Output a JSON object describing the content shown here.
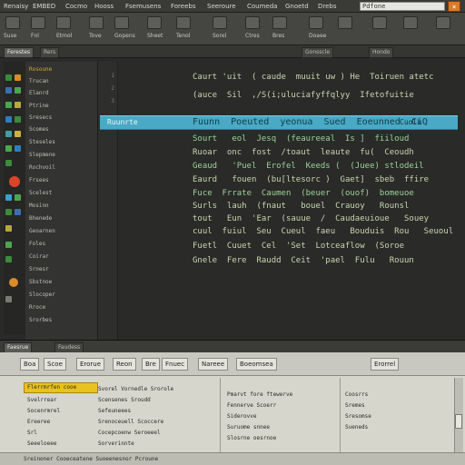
{
  "menubar": {
    "items": [
      "Renaisy",
      "EMBED",
      "Cocmo",
      "Hooss",
      "Fsemusens",
      "Foreebs",
      "Seeroure",
      "Coumeda",
      "Gnoetd",
      "Drebs"
    ],
    "title_field": "Pdfone",
    "close_icon": "close-icon"
  },
  "toolbar": {
    "labels": [
      "Suse",
      "Fnl",
      "Etmol",
      "Tove",
      "Gopens",
      "Sheet",
      "Tenol",
      "Sorel",
      "Ctres",
      "Bres",
      "Doaee"
    ]
  },
  "tabs": [
    "Ferestes",
    "Rers",
    "Gonsscle",
    "Hondo"
  ],
  "explorer": {
    "items": [
      "Rosoune",
      "Trucan",
      "Elanrd",
      "Ptrine",
      "Sresecs",
      "Scomes",
      "Steseles",
      "Slepmene",
      "Rochvoil",
      "Frsees",
      "Scelest",
      "Mosinn",
      "Bhenede",
      "Geoarnen",
      "Foles",
      "Coirar",
      "Srnesr",
      "Sbstnoe",
      "Slocoper",
      "Rroce",
      "Srorbes"
    ]
  },
  "editor": {
    "line_numbers": [
      "1",
      "2",
      "3",
      "4",
      "5",
      "6",
      "7",
      "8",
      "9",
      "10",
      "11",
      "12",
      "13",
      "14",
      "15",
      "16",
      "17",
      "18",
      "19",
      "20"
    ],
    "lines": [
      {
        "text": "Caurt 'uit  ( caude  muuit uw ) He  Toiruen atetc",
        "cls": "c"
      },
      {
        "text": "(auce  Sil  ,/S(i;uluciafyffqlyy  Ifetofuitie",
        "cls": "c"
      },
      {
        "text": "Sourt   eol  Jesq  (feaureeal  Is ]  fiiloud",
        "cls": "g"
      },
      {
        "text": "Ruoar  onc  fost  /toaut  leaute  fu(  Ceoudh",
        "cls": "c"
      },
      {
        "text": "Geaud   'Puel  Erofel  Keeds (  (Juee) stlodeil",
        "cls": "g"
      },
      {
        "text": "Eaurd   fouen  (bu[ltesorc )  Gaet]  sbeb  ffire",
        "cls": "c"
      },
      {
        "text": "Fuce  Frrate  Caumen  (beuer  (ouof)  bomeuoe",
        "cls": "g"
      },
      {
        "text": "Surls  lauh  (fnaut   bouel  Crauoy   Rounsl",
        "cls": "c"
      },
      {
        "text": "tout   Eun  'Ear  (sauue  /  Caudaeuioue   Souey",
        "cls": "c"
      },
      {
        "text": "cuul  fuiul  Seu  Cueul  faeu   Bouduis  Rou   Seuoul",
        "cls": "c"
      },
      {
        "text": "Fuetl  Cuuet  Cel  'Set  Lotceaflow  (Soroe",
        "cls": "c"
      },
      {
        "text": "Gnele  Fere  Raudd  Ceit  'pael  Fulu   Rouun",
        "cls": "c"
      }
    ],
    "highlight": {
      "label": "Ruunrte",
      "code": "Fuunn  Poeuted  yeonua  Sued  Eoeunned  CiQ",
      "side": "Cuolu"
    }
  },
  "dock": {
    "header": [
      "Faesrue",
      "Faudess"
    ],
    "toolbar": [
      "Boa",
      "Scoe",
      "Erorue",
      "Reon",
      "Bre",
      "Fnuec",
      "Nareee",
      "Boeomsea",
      "Erorrel"
    ],
    "left_rows": [
      "Flerrmrfen cooe",
      "Svelrrear",
      "Socenrmrel",
      "Ereeree",
      "Srl",
      "Seeeloeee",
      "Sowlm",
      "Seee"
    ],
    "mid_rows": [
      "Svorel  Vornedle  Srorole",
      "Scensenes  Sroudd",
      "Sefeuneees",
      "Srenoceuell  Scoccere",
      "Cocepcoenw  Seroeeel",
      "Sorverinnte",
      "Svrollmsers  Socnen",
      "Sovenemanenve"
    ],
    "right_rows": [
      "Pmarvt  fore ftewerve",
      "Fennerve  Scoerr",
      "Siderovve",
      "Suruome  snnee",
      "Slosrne  oesrnoe",
      "Srenmer  Sorc",
      "Srordemeree",
      "Sorrremenees"
    ],
    "far_rows": [
      "Coosrrs",
      "Sremes",
      "Sresomse",
      "Sueneds",
      "Srernme",
      "Srnseeas"
    ],
    "footer": "Sreinoner  Cooeceatene  Suoeenesnor  Pcroune"
  }
}
